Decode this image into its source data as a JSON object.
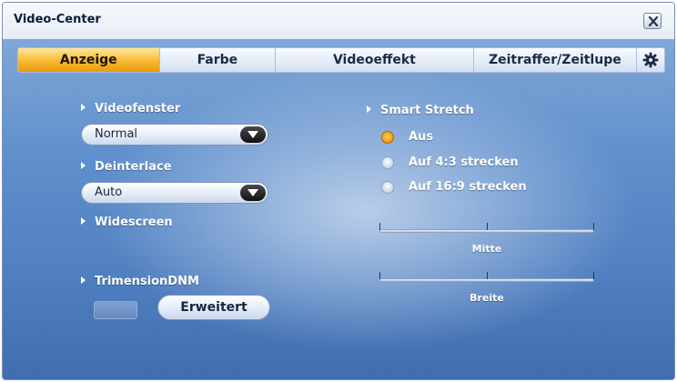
{
  "window": {
    "title": "Video-Center"
  },
  "icons": {
    "close": "close-icon",
    "settings": "gear-icon"
  },
  "tabs": [
    {
      "label": "Anzeige",
      "active": true
    },
    {
      "label": "Farbe",
      "active": false
    },
    {
      "label": "Videoeffekt",
      "active": false
    },
    {
      "label": "Zeitraffer/Zeitlupe",
      "active": false
    }
  ],
  "left": {
    "videofenster": {
      "label": "Videofenster",
      "value": "Normal"
    },
    "deinterlace": {
      "label": "Deinterlace",
      "value": "Auto"
    },
    "widescreen": {
      "label": "Widescreen"
    },
    "trimension": {
      "label": "TrimensionDNM",
      "button": "Erweitert"
    }
  },
  "right": {
    "smart_stretch": {
      "label": "Smart Stretch",
      "options": [
        {
          "label": "Aus",
          "checked": true
        },
        {
          "label": "Auf 4:3 strecken",
          "checked": false
        },
        {
          "label": "Auf 16:9 strecken",
          "checked": false
        }
      ]
    },
    "sliders": [
      {
        "label": "Mitte"
      },
      {
        "label": "Breite"
      }
    ]
  },
  "colors": {
    "accent": "#f6b52a",
    "background": "#5f8fcc"
  }
}
